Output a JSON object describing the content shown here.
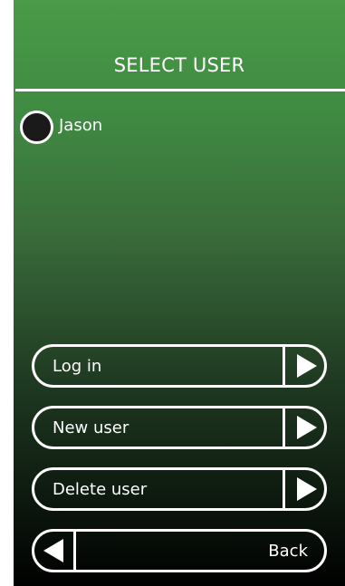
{
  "header": {
    "title": "SELECT USER"
  },
  "users": [
    {
      "name": "Jason",
      "selected": false
    }
  ],
  "buttons": {
    "login_label": "Log in",
    "new_user_label": "New user",
    "delete_user_label": "Delete user",
    "back_label": "Back"
  },
  "icons": {
    "forward": "arrow-right-icon",
    "back": "arrow-left-icon"
  },
  "colors": {
    "top_green": "#4a9a48",
    "bottom": "#000000",
    "foreground": "#ffffff"
  }
}
